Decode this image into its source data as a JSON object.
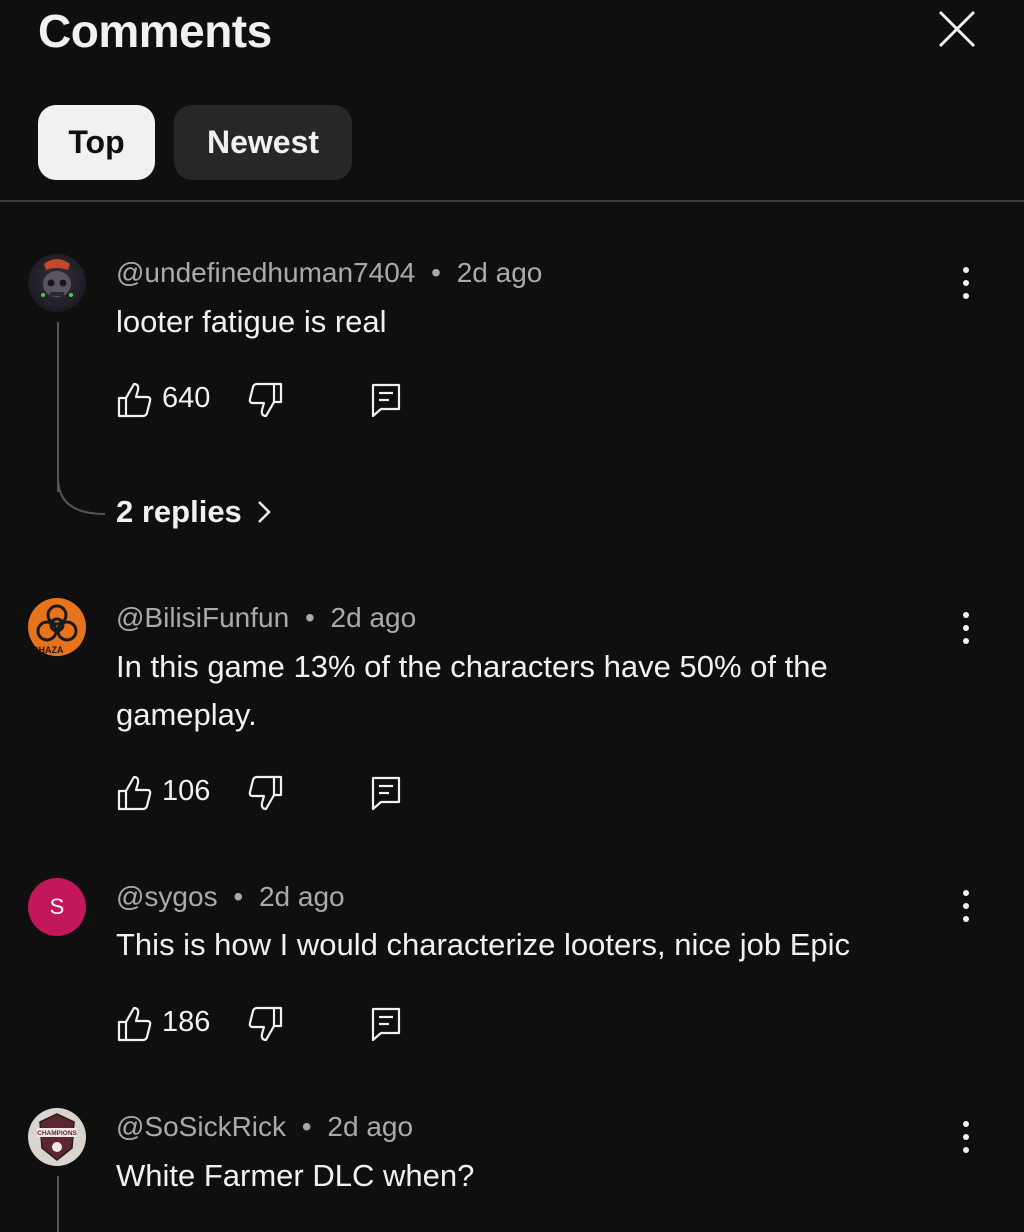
{
  "header": {
    "title": "Comments",
    "tabs": [
      {
        "label": "Top",
        "selected": true
      },
      {
        "label": "Newest",
        "selected": false
      }
    ]
  },
  "comments": [
    {
      "handle": "@undefinedhuman7404",
      "time": "2d ago",
      "text": "looter fatigue is real",
      "likes": "640",
      "replies_label": "2 replies",
      "avatar_icon": "skull-avatar"
    },
    {
      "handle": "@BilisiFunfun",
      "time": "2d ago",
      "text": "In this game 13% of the characters have 50% of the gameplay.",
      "likes": "106",
      "avatar_icon": "biohazard-avatar",
      "avatar_badge": "BHAZA"
    },
    {
      "handle": "@sygos",
      "time": "2d ago",
      "text": "This is how I would characterize looters, nice job Epic",
      "likes": "186",
      "avatar_letter": "S",
      "avatar_color": "#c2185b"
    },
    {
      "handle": "@SoSickRick",
      "time": "2d ago",
      "text": "White Farmer DLC when?",
      "avatar_icon": "champions-badge-avatar",
      "avatar_badge": "CHAMPIONS"
    }
  ],
  "separator": "•",
  "colors": {
    "background": "#0f0f0f",
    "text": "#f1f1f1",
    "meta": "#aaaaaa",
    "chip_active_bg": "#f1f1f1",
    "chip_inactive_bg": "#272727"
  }
}
